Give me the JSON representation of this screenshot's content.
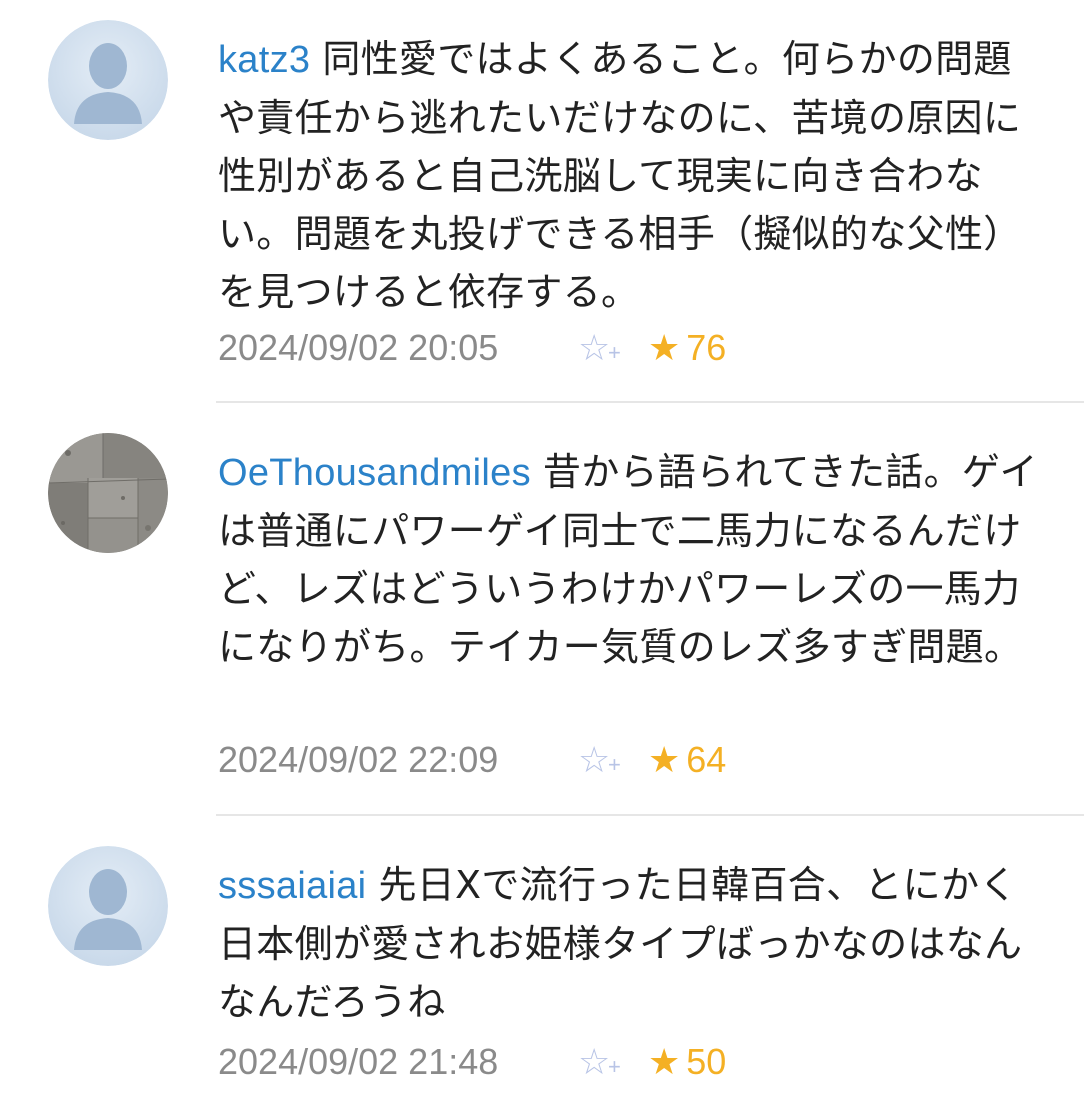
{
  "comments": [
    {
      "user": "katz3",
      "text": "同性愛ではよくあること。何らかの問題や責任から逃れたいだけなのに、苦境の原因に性別があると自己洗脳して現実に向き合わない。問題を丸投げできる相手（擬似的な父性）を見つけると依存する。",
      "date": "2024/09/02 20:05",
      "likes": "76",
      "avatar": "default-person-icon"
    },
    {
      "user": "OeThousandmiles",
      "text": "昔から語られてきた話。ゲイは普通にパワーゲイ同士で二馬力になるんだけど、レズはどういうわけかパワーレズの一馬力になりがち。テイカー気質のレズ多すぎ問題。",
      "date": "2024/09/02 22:09",
      "likes": "64",
      "avatar": "stone-texture-photo"
    },
    {
      "user": "sssaiaiai",
      "text": "先日Xで流行った日韓百合、とにかく日本側が愛されお姫様タイプばっかなのはなんなんだろうね",
      "date": "2024/09/02 21:48",
      "likes": "50",
      "avatar": "default-person-icon"
    }
  ],
  "icons": {
    "add_favorite": "star-plus-icon",
    "score": "star-icon"
  },
  "glyphs": {
    "outline_star": "☆",
    "plus": "+",
    "solid_star": "★"
  },
  "colors": {
    "username": "#2b82c9",
    "body_text": "#222222",
    "date": "#8a8a8a",
    "star_accent": "#f4b024",
    "star_outline": "#b8c4e6",
    "divider": "#e6e6e6"
  }
}
